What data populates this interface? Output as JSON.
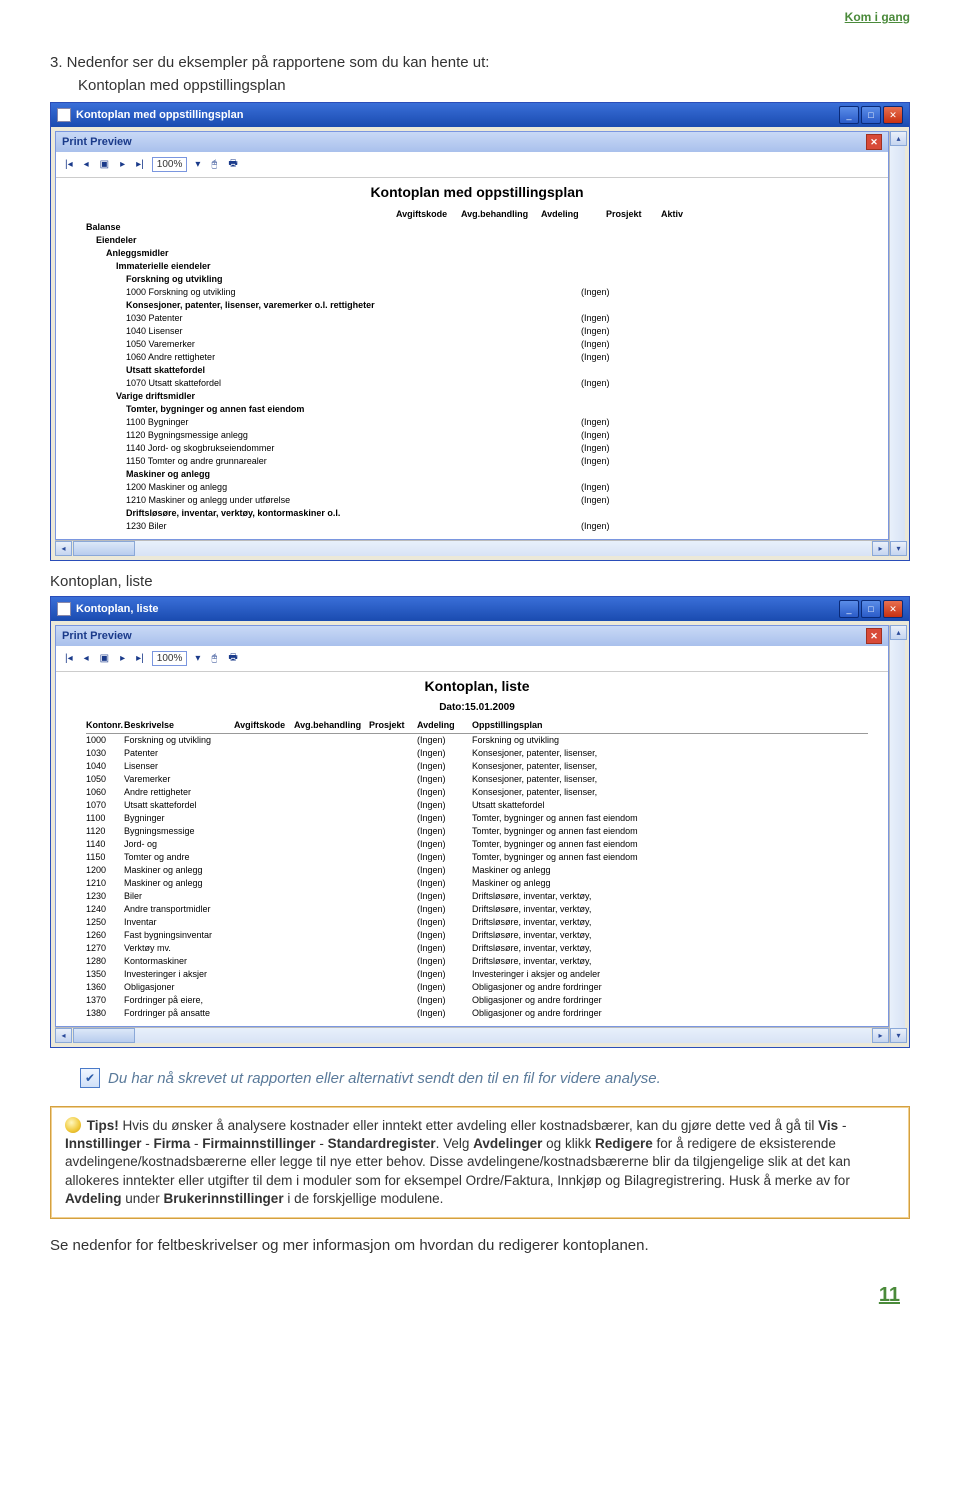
{
  "header_link": "Kom i gang",
  "intro_line": "3.   Nedenfor ser du eksempler på rapportene som du kan hente ut:",
  "intro_sub": "Kontoplan med oppstillingsplan",
  "caption2": "Kontoplan, liste",
  "win1": {
    "title": "Kontoplan med oppstillingsplan",
    "preview_label": "Print Preview",
    "zoom": "100%",
    "report_title": "Kontoplan med oppstillingsplan",
    "headers": {
      "avgkode": "Avgiftskode",
      "avgbeh": "Avg.behandling",
      "avdeling": "Avdeling",
      "prosjekt": "Prosjekt",
      "aktiv": "Aktiv"
    },
    "sections": [
      {
        "lvl": 0,
        "bold": true,
        "text": "Balanse"
      },
      {
        "lvl": 1,
        "bold": true,
        "text": "Eiendeler"
      },
      {
        "lvl": 2,
        "bold": true,
        "text": "Anleggsmidler"
      },
      {
        "lvl": 3,
        "bold": true,
        "text": "Immaterielle eiendeler"
      },
      {
        "lvl": 4,
        "bold": true,
        "text": "Forskning og utvikling"
      },
      {
        "lvl": 4,
        "bold": false,
        "text": "1000   Forskning og utvikling",
        "avd": "(Ingen)"
      },
      {
        "lvl": 4,
        "bold": true,
        "text": "Konsesjoner, patenter, lisenser, varemerker o.l. rettigheter"
      },
      {
        "lvl": 4,
        "bold": false,
        "text": "1030   Patenter",
        "avd": "(Ingen)"
      },
      {
        "lvl": 4,
        "bold": false,
        "text": "1040   Lisenser",
        "avd": "(Ingen)"
      },
      {
        "lvl": 4,
        "bold": false,
        "text": "1050   Varemerker",
        "avd": "(Ingen)"
      },
      {
        "lvl": 4,
        "bold": false,
        "text": "1060   Andre rettigheter",
        "avd": "(Ingen)"
      },
      {
        "lvl": 4,
        "bold": true,
        "text": "Utsatt skattefordel"
      },
      {
        "lvl": 4,
        "bold": false,
        "text": "1070   Utsatt skattefordel",
        "avd": "(Ingen)"
      },
      {
        "lvl": 3,
        "bold": true,
        "text": "Varige driftsmidler"
      },
      {
        "lvl": 4,
        "bold": true,
        "text": "Tomter, bygninger og annen fast eiendom"
      },
      {
        "lvl": 4,
        "bold": false,
        "text": "1100   Bygninger",
        "avd": "(Ingen)"
      },
      {
        "lvl": 4,
        "bold": false,
        "text": "1120   Bygningsmessige anlegg",
        "avd": "(Ingen)"
      },
      {
        "lvl": 4,
        "bold": false,
        "text": "1140   Jord- og skogbrukseiendommer",
        "avd": "(Ingen)"
      },
      {
        "lvl": 4,
        "bold": false,
        "text": "1150   Tomter og andre grunnarealer",
        "avd": "(Ingen)"
      },
      {
        "lvl": 4,
        "bold": true,
        "text": "Maskiner og anlegg"
      },
      {
        "lvl": 4,
        "bold": false,
        "text": "1200   Maskiner og anlegg",
        "avd": "(Ingen)"
      },
      {
        "lvl": 4,
        "bold": false,
        "text": "1210   Maskiner og anlegg under utførelse",
        "avd": "(Ingen)"
      },
      {
        "lvl": 4,
        "bold": true,
        "text": "Driftsløsøre, inventar, verktøy, kontormaskiner o.l."
      },
      {
        "lvl": 4,
        "bold": false,
        "text": "1230   Biler",
        "avd": "(Ingen)"
      }
    ]
  },
  "win2": {
    "title": "Kontoplan, liste",
    "preview_label": "Print Preview",
    "zoom": "100%",
    "report_title": "Kontoplan, liste",
    "date": "Dato:15.01.2009",
    "headers": {
      "kontonr": "Kontonr.",
      "beskr": "Beskrivelse",
      "avgkode": "Avgiftskode",
      "avgbeh": "Avg.behandling",
      "prosjekt": "Prosjekt",
      "avdeling": "Avdeling",
      "opp": "Oppstillingsplan"
    },
    "rows": [
      {
        "nr": "1000",
        "bes": "Forskning og utvikling",
        "avd": "(Ingen)",
        "opp": "Forskning og utvikling"
      },
      {
        "nr": "1030",
        "bes": "Patenter",
        "avd": "(Ingen)",
        "opp": "Konsesjoner, patenter, lisenser,"
      },
      {
        "nr": "1040",
        "bes": "Lisenser",
        "avd": "(Ingen)",
        "opp": "Konsesjoner, patenter, lisenser,"
      },
      {
        "nr": "1050",
        "bes": "Varemerker",
        "avd": "(Ingen)",
        "opp": "Konsesjoner, patenter, lisenser,"
      },
      {
        "nr": "1060",
        "bes": "Andre rettigheter",
        "avd": "(Ingen)",
        "opp": "Konsesjoner, patenter, lisenser,"
      },
      {
        "nr": "1070",
        "bes": "Utsatt skattefordel",
        "avd": "(Ingen)",
        "opp": "Utsatt skattefordel"
      },
      {
        "nr": "1100",
        "bes": "Bygninger",
        "avd": "(Ingen)",
        "opp": "Tomter, bygninger og annen fast eiendom"
      },
      {
        "nr": "1120",
        "bes": "Bygningsmessige",
        "avd": "(Ingen)",
        "opp": "Tomter, bygninger og annen fast eiendom"
      },
      {
        "nr": "1140",
        "bes": "Jord- og",
        "avd": "(Ingen)",
        "opp": "Tomter, bygninger og annen fast eiendom"
      },
      {
        "nr": "1150",
        "bes": "Tomter og andre",
        "avd": "(Ingen)",
        "opp": "Tomter, bygninger og annen fast eiendom"
      },
      {
        "nr": "1200",
        "bes": "Maskiner og anlegg",
        "avd": "(Ingen)",
        "opp": "Maskiner og anlegg"
      },
      {
        "nr": "1210",
        "bes": "Maskiner og anlegg",
        "avd": "(Ingen)",
        "opp": "Maskiner og anlegg"
      },
      {
        "nr": "1230",
        "bes": "Biler",
        "avd": "(Ingen)",
        "opp": "Driftsløsøre, inventar, verktøy,"
      },
      {
        "nr": "1240",
        "bes": "Andre transportmidler",
        "avd": "(Ingen)",
        "opp": "Driftsløsøre, inventar, verktøy,"
      },
      {
        "nr": "1250",
        "bes": "Inventar",
        "avd": "(Ingen)",
        "opp": "Driftsløsøre, inventar, verktøy,"
      },
      {
        "nr": "1260",
        "bes": "Fast bygningsinventar",
        "avd": "(Ingen)",
        "opp": "Driftsløsøre, inventar, verktøy,"
      },
      {
        "nr": "1270",
        "bes": "Verktøy mv.",
        "avd": "(Ingen)",
        "opp": "Driftsløsøre, inventar, verktøy,"
      },
      {
        "nr": "1280",
        "bes": "Kontormaskiner",
        "avd": "(Ingen)",
        "opp": "Driftsløsøre, inventar, verktøy,"
      },
      {
        "nr": "1350",
        "bes": "Investeringer i aksjer",
        "avd": "(Ingen)",
        "opp": "Investeringer i aksjer og andeler"
      },
      {
        "nr": "1360",
        "bes": "Obligasjoner",
        "avd": "(Ingen)",
        "opp": "Obligasjoner og andre fordringer"
      },
      {
        "nr": "1370",
        "bes": "Fordringer på eiere,",
        "avd": "(Ingen)",
        "opp": "Obligasjoner og andre fordringer"
      },
      {
        "nr": "1380",
        "bes": "Fordringer på ansatte",
        "avd": "(Ingen)",
        "opp": "Obligasjoner og andre fordringer"
      }
    ]
  },
  "note_text": "Du har nå skrevet ut rapporten eller alternativt sendt den til en fil for videre analyse.",
  "tips": {
    "label": "Tips!",
    "body1": " Hvis du ønsker å analysere kostnader eller inntekt etter avdeling eller kostnadsbærer, kan du gjøre dette ved å gå til ",
    "b_vis": "Vis",
    "dash1": " - ",
    "b_inn": "Innstillinger",
    "dash2": " - ",
    "b_firma": "Firma",
    "dash3": " - ",
    "b_firmainn": "Firmainnstillinger",
    "dash4": " - ",
    "b_std": "Standardregister",
    "body2": ". Velg ",
    "b_avd": "Avdelinger",
    "body3": " og klikk ",
    "b_red": "Redigere",
    "body4": " for å redigere de eksisterende avdelingene/kostnadsbærerne eller legge til nye etter behov. Disse avdelingene/kostnadsbærerne blir da tilgjengelige slik at det kan allokeres inntekter eller utgifter til dem i moduler som for eksempel Ordre/Faktura, Innkjøp og Bilagregistrering. Husk å merke av for ",
    "b_avd2": "Avdeling",
    "body5": " under ",
    "b_bruker": "Brukerinnstillinger",
    "body6": " i de forskjellige modulene."
  },
  "footer": "Se nedenfor for feltbeskrivelser og mer informasjon om hvordan du redigerer kontoplanen.",
  "page_number": "11"
}
